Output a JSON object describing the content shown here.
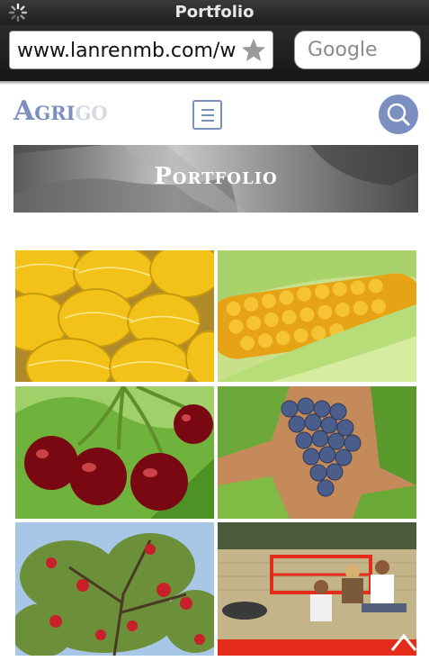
{
  "browser": {
    "title": "Portfolio",
    "url": "www.lanrenmb.com/w",
    "search_placeholder": "Google"
  },
  "site": {
    "logo_part1": "Agri",
    "logo_part2": "go",
    "banner_title": "Portfolio"
  },
  "gallery": [
    {
      "name": "melons",
      "subject": "yellow melons"
    },
    {
      "name": "corn",
      "subject": "corn cob"
    },
    {
      "name": "cherries",
      "subject": "red cherries"
    },
    {
      "name": "grapes",
      "subject": "blue grapes"
    },
    {
      "name": "apples",
      "subject": "apple tree"
    },
    {
      "name": "farmers",
      "subject": "farmers resting in field"
    }
  ],
  "colors": {
    "accent": "#7b8fc0",
    "logo_light": "#d4d8e2",
    "chrome_dark": "#1e1e1e"
  }
}
